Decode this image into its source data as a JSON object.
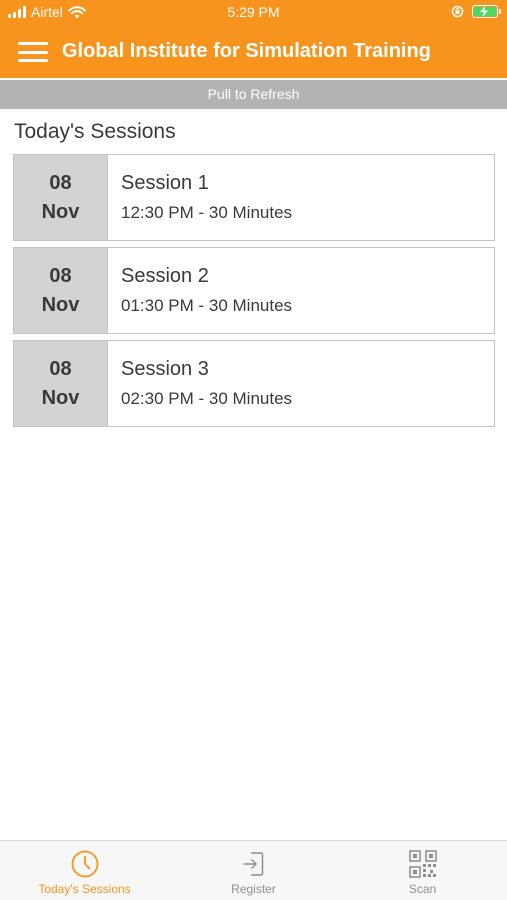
{
  "status_bar": {
    "carrier": "Airtel",
    "time": "5:29 PM"
  },
  "header": {
    "title": "Global Institute for Simulation Training"
  },
  "refresh": {
    "label": "Pull to Refresh"
  },
  "sessions_section": {
    "title": "Today's Sessions"
  },
  "sessions": [
    {
      "day": "08",
      "month": "Nov",
      "name": "Session 1",
      "time": "12:30 PM - 30 Minutes"
    },
    {
      "day": "08",
      "month": "Nov",
      "name": "Session 2",
      "time": "01:30 PM - 30 Minutes"
    },
    {
      "day": "08",
      "month": "Nov",
      "name": "Session 3",
      "time": "02:30 PM - 30 Minutes"
    }
  ],
  "tabs": [
    {
      "label": "Today's Sessions",
      "icon": "clock-icon",
      "active": true
    },
    {
      "label": "Register",
      "icon": "sign-in-icon",
      "active": false
    },
    {
      "label": "Scan",
      "icon": "qr-code-icon",
      "active": false
    }
  ],
  "colors": {
    "accent": "#f7941d",
    "refresh_bar": "#b3b3b3",
    "date_box": "#d3d3d3",
    "tab_inactive": "#8e8e93"
  }
}
